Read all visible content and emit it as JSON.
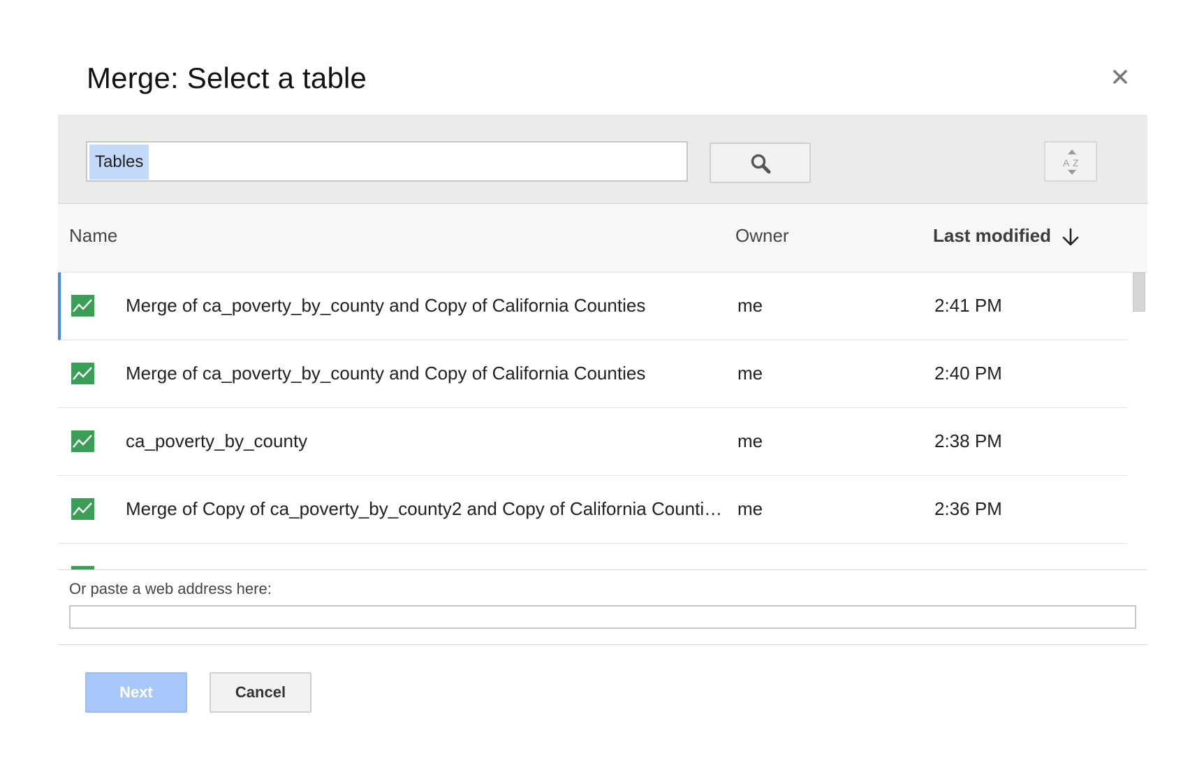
{
  "dialog": {
    "title": "Merge: Select a table"
  },
  "search": {
    "chip_label": "Tables",
    "value": ""
  },
  "columns": {
    "name": "Name",
    "owner": "Owner",
    "last_modified": "Last modified"
  },
  "rows": [
    {
      "name": "Merge of ca_poverty_by_county and Copy of California Counties",
      "owner": "me",
      "modified": "2:41 PM",
      "selected": true
    },
    {
      "name": "Merge of ca_poverty_by_county and Copy of California Counties",
      "owner": "me",
      "modified": "2:40 PM",
      "selected": false
    },
    {
      "name": "ca_poverty_by_county",
      "owner": "me",
      "modified": "2:38 PM",
      "selected": false
    },
    {
      "name": "Merge of Copy of ca_poverty_by_county2 and Copy of California Counti…",
      "owner": "me",
      "modified": "2:36 PM",
      "selected": false
    }
  ],
  "paste": {
    "label": "Or paste a web address here:",
    "value": ""
  },
  "buttons": {
    "next": "Next",
    "cancel": "Cancel"
  },
  "icons": {
    "table": "fusion-table-chart-icon",
    "search": "search-icon",
    "sort": "sort-az-icon",
    "close": "close-icon",
    "sort_direction": "arrow-down-icon"
  },
  "colors": {
    "accent": "#4a86e8",
    "table_icon": "#3b9e57",
    "next_disabled": "#a8c7fa",
    "chip": "#c4d9f7"
  }
}
